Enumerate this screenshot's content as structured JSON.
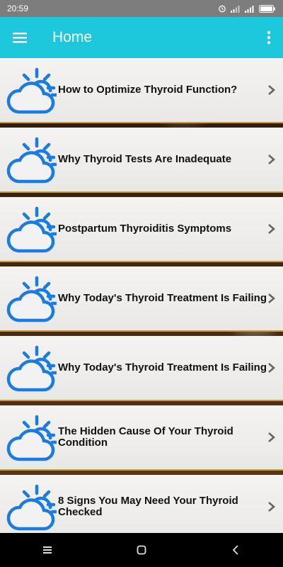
{
  "status_bar": {
    "time": "20:59",
    "icons": [
      "alarm-icon",
      "signal-icon",
      "signal-icon",
      "battery-icon"
    ]
  },
  "app_bar": {
    "title": "Home",
    "menu_icon": "hamburger-menu-icon",
    "more_icon": "more-vert-icon"
  },
  "colors": {
    "app_bar": "#1ec8dc",
    "icon_blue": "#1a7be0",
    "status_bar": "#7d7d7d"
  },
  "items": [
    {
      "label": "How to Optimize Thyroid Function?",
      "icon": "sun-cloud-icon"
    },
    {
      "label": "Why Thyroid Tests Are Inadequate",
      "icon": "sun-cloud-icon"
    },
    {
      "label": "Postpartum Thyroiditis Symptoms",
      "icon": "sun-cloud-icon"
    },
    {
      "label": "Why Today's Thyroid Treatment Is Failing",
      "icon": "sun-cloud-icon"
    },
    {
      "label": "Why Today's Thyroid Treatment Is Failing",
      "icon": "sun-cloud-icon"
    },
    {
      "label": "The Hidden Cause Of Your Thyroid Condition",
      "icon": "sun-cloud-icon"
    },
    {
      "label": "8 Signs You May Need Your Thyroid Checked",
      "icon": "sun-cloud-icon"
    }
  ],
  "nav_bar": {
    "buttons": [
      "recent-apps-icon",
      "home-icon",
      "back-icon"
    ]
  }
}
